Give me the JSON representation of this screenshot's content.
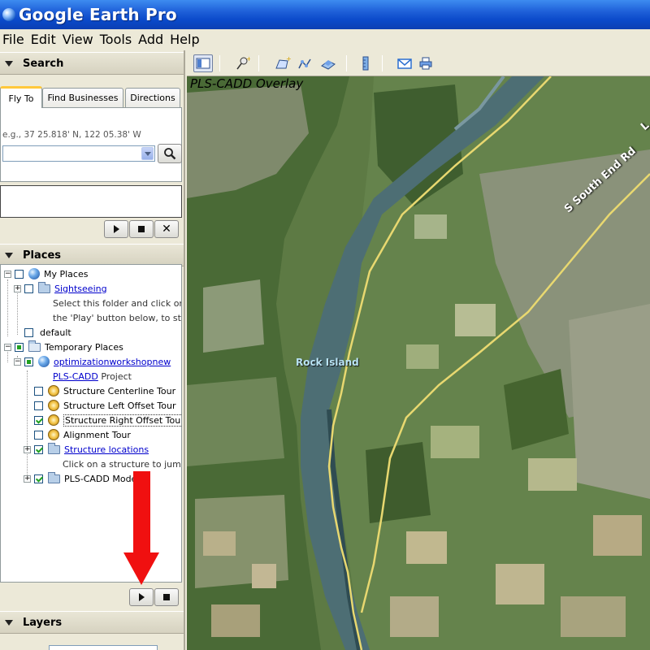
{
  "window": {
    "title": "Google Earth Pro"
  },
  "menu": [
    "File",
    "Edit",
    "View",
    "Tools",
    "Add",
    "Help"
  ],
  "search": {
    "header": "Search",
    "tabs": [
      "Fly To",
      "Find Businesses",
      "Directions"
    ],
    "hint": "e.g., 37 25.818' N, 122 05.38' W",
    "input_value": ""
  },
  "places": {
    "header": "Places",
    "tree": {
      "my_places": "My Places",
      "sightseeing": "Sightseeing",
      "sightseeing_desc_1": "Select this folder and click on",
      "sightseeing_desc_2": "the 'Play' button below, to start th",
      "default": "default",
      "temporary_places": "Temporary Places",
      "workshop": "optimizationworkshopnew",
      "plscadd_link": "PLS-CADD",
      "plscadd_rest": " Project",
      "tour_centerline": "Structure Centerline Tour",
      "tour_left": "Structure Left Offset Tour",
      "tour_right": "Structure Right Offset Tour",
      "tour_alignment": "Alignment Tour",
      "structure_locations": "Structure locations",
      "structure_desc": "Click on a structure to jump to",
      "plscadd_model": "PLS-CADD Model"
    }
  },
  "layers": {
    "header": "Layers"
  },
  "map": {
    "overlay_title": "PLS-CADD Overlay",
    "place_label": "Rock Island",
    "road_label": "S South End Rd",
    "road_label_partial": "L"
  },
  "colors": {
    "titlebar": "#0a49c9",
    "annotation_arrow": "#f01010",
    "road": "#e8d870"
  }
}
